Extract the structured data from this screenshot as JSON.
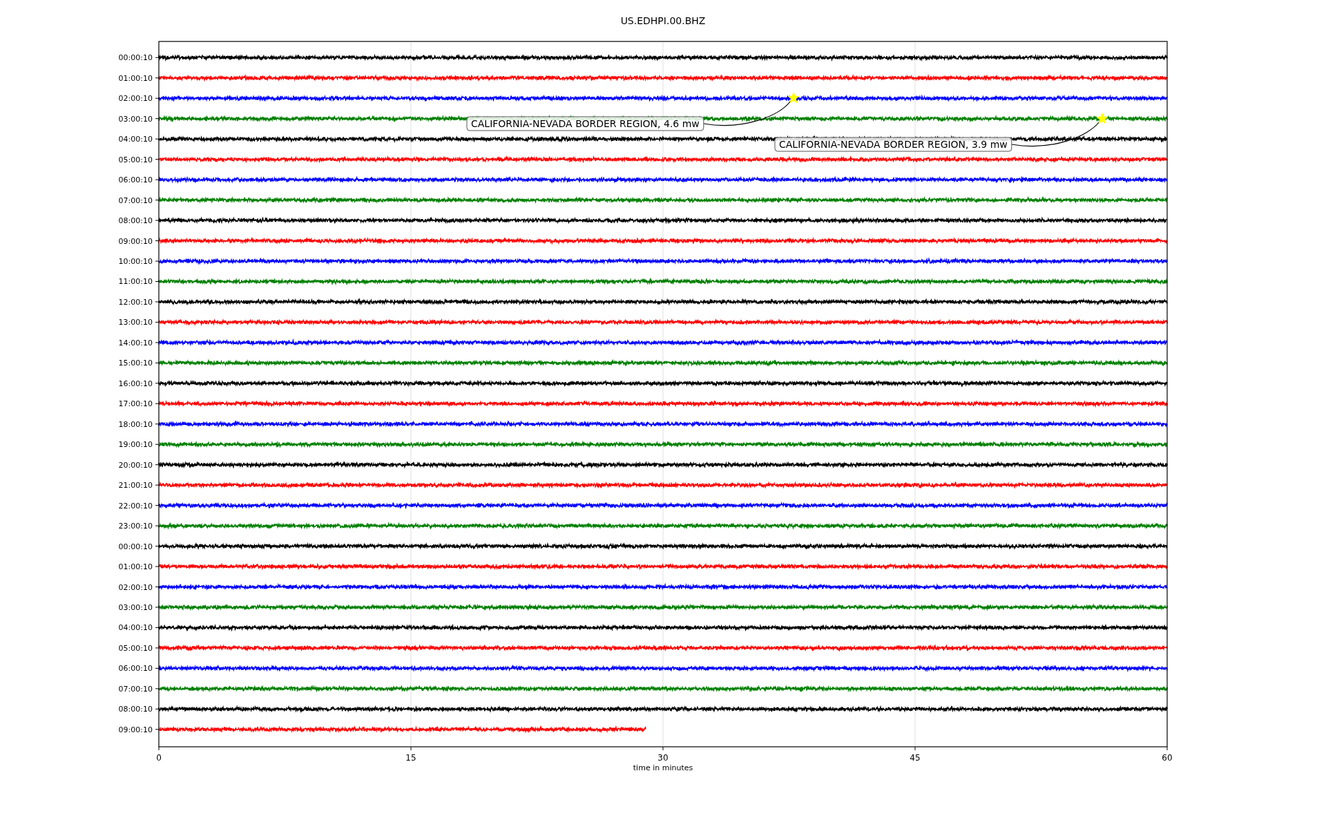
{
  "title": "US.EDHPI.00.BHZ",
  "rows": [
    {
      "label": "00:00:10",
      "color": "#000000",
      "level": 1
    },
    {
      "label": "01:00:10",
      "color": "#ff0000",
      "level": 1
    },
    {
      "label": "02:00:10",
      "color": "#0000ff",
      "level": 1
    },
    {
      "label": "03:00:10",
      "color": "#008000",
      "level": 1
    },
    {
      "label": "04:00:10",
      "color": "#000000",
      "level": 1
    },
    {
      "label": "05:00:10",
      "color": "#ff0000",
      "level": 1
    },
    {
      "label": "06:00:10",
      "color": "#0000ff",
      "level": 1
    },
    {
      "label": "07:00:10",
      "color": "#008000",
      "level": 1
    },
    {
      "label": "08:00:10",
      "color": "#000000",
      "level": 1
    },
    {
      "label": "09:00:10",
      "color": "#ff0000",
      "level": 1
    },
    {
      "label": "10:00:10",
      "color": "#0000ff",
      "level": 1
    },
    {
      "label": "11:00:10",
      "color": "#008000",
      "level": 1
    },
    {
      "label": "12:00:10",
      "color": "#000000",
      "level": 1
    },
    {
      "label": "13:00:10",
      "color": "#ff0000",
      "level": 1
    },
    {
      "label": "14:00:10",
      "color": "#0000ff",
      "level": 1
    },
    {
      "label": "15:00:10",
      "color": "#008000",
      "level": 1
    },
    {
      "label": "16:00:10",
      "color": "#000000",
      "level": 1
    },
    {
      "label": "17:00:10",
      "color": "#ff0000",
      "level": 1
    },
    {
      "label": "18:00:10",
      "color": "#0000ff",
      "level": 1
    },
    {
      "label": "19:00:10",
      "color": "#008000",
      "level": 1
    },
    {
      "label": "20:00:10",
      "color": "#000000",
      "level": 1
    },
    {
      "label": "21:00:10",
      "color": "#ff0000",
      "level": 1
    },
    {
      "label": "22:00:10",
      "color": "#0000ff",
      "level": 1
    },
    {
      "label": "23:00:10",
      "color": "#008000",
      "level": 1
    },
    {
      "label": "00:00:10",
      "color": "#000000",
      "level": 1
    },
    {
      "label": "01:00:10",
      "color": "#ff0000",
      "level": 1
    },
    {
      "label": "02:00:10",
      "color": "#0000ff",
      "level": 1
    },
    {
      "label": "03:00:10",
      "color": "#008000",
      "level": 1
    },
    {
      "label": "04:00:10",
      "color": "#000000",
      "level": 1
    },
    {
      "label": "05:00:10",
      "color": "#ff0000",
      "level": 1
    },
    {
      "label": "06:00:10",
      "color": "#0000ff",
      "level": 1
    },
    {
      "label": "07:00:10",
      "color": "#008000",
      "level": 1
    },
    {
      "label": "08:00:10",
      "color": "#000000",
      "level": 1
    },
    {
      "label": "09:00:10",
      "color": "#ff0000",
      "level": 0.483
    }
  ],
  "x_axis": {
    "label": "time in minutes",
    "ticks": [
      "0",
      "15",
      "30",
      "45",
      "60"
    ]
  },
  "events": [
    {
      "text": "CALIFORNIA-NEVADA BORDER REGION, 4.6 mw"
    },
    {
      "text": "CALIFORNIA-NEVADA BORDER REGION, 3.9 mw"
    }
  ]
}
